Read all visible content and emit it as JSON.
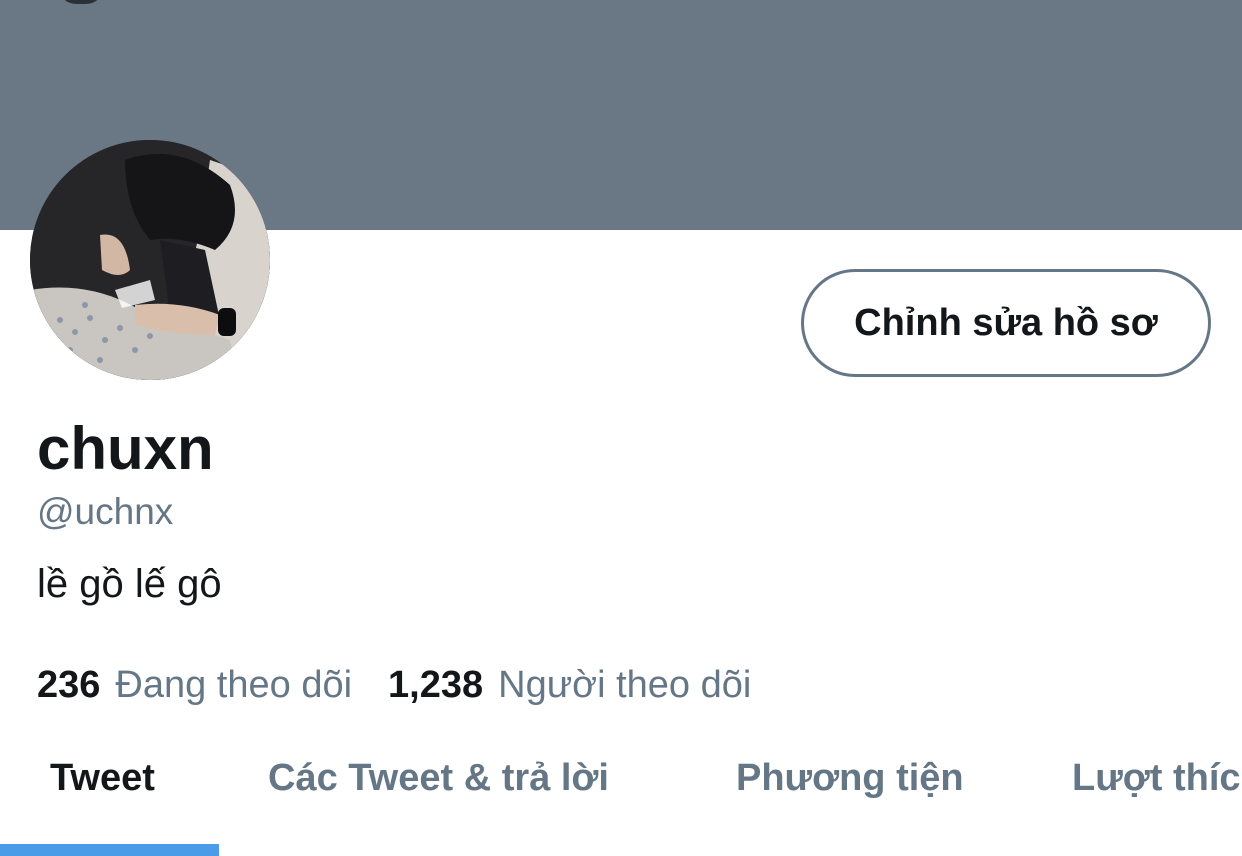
{
  "profile": {
    "edit_button_label": "Chỉnh sửa hồ sơ",
    "display_name": "chuxn",
    "handle": "@uchnx",
    "bio": "lề gồ lế gô",
    "following_count": "236",
    "following_label": "Đang theo dõi",
    "followers_count": "1,238",
    "followers_label": "Người theo dõi"
  },
  "tabs": [
    {
      "label": "Tweet",
      "active": true
    },
    {
      "label": "Các Tweet & trả lời",
      "active": false
    },
    {
      "label": "Phương tiện",
      "active": false
    },
    {
      "label": "Lượt thích",
      "active": false
    }
  ],
  "colors": {
    "banner": "#6a7785",
    "accent": "#4a9ce8",
    "secondary_text": "#657786",
    "primary_text": "#14171a"
  }
}
